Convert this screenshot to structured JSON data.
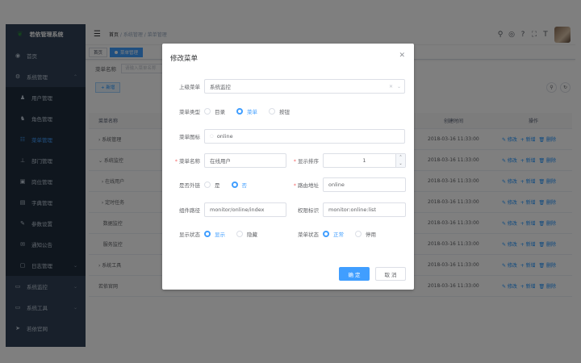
{
  "sidebar": {
    "logo_text": "若依管理系统",
    "items": [
      {
        "label": "首页",
        "icon": "dashboard-icon"
      },
      {
        "label": "系统管理",
        "icon": "gear-icon"
      },
      {
        "label": "用户管理",
        "icon": "user-icon"
      },
      {
        "label": "角色管理",
        "icon": "peoples-icon"
      },
      {
        "label": "菜单管理",
        "icon": "tree-table-icon"
      },
      {
        "label": "部门管理",
        "icon": "tree-icon"
      },
      {
        "label": "岗位管理",
        "icon": "post-icon"
      },
      {
        "label": "字典管理",
        "icon": "dict-icon"
      },
      {
        "label": "参数设置",
        "icon": "edit-icon"
      },
      {
        "label": "通知公告",
        "icon": "message-icon"
      },
      {
        "label": "日志管理",
        "icon": "log-icon"
      },
      {
        "label": "系统监控",
        "icon": "monitor-icon"
      },
      {
        "label": "系统工具",
        "icon": "tool-icon"
      },
      {
        "label": "若依官网",
        "icon": "guide-icon"
      }
    ]
  },
  "navbar": {
    "crumb_1": "首页",
    "sep": "/",
    "crumb_2": "系统管理",
    "crumb_3": "菜单管理"
  },
  "tags": {
    "home": "首页",
    "active": "菜单管理"
  },
  "search": {
    "label": "菜单名称",
    "placeholder": "请输入菜单名称"
  },
  "toolbar": {
    "add_label": "+ 新增"
  },
  "table": {
    "headers": {
      "name": "菜单名称",
      "time": "创建时间",
      "op": "操作"
    },
    "rows": [
      {
        "name": "› 系统管理",
        "time": "2018-03-16 11:33:00",
        "op": "✎ 修改  + 新增  🗑 删除"
      },
      {
        "name": "⌄ 系统监控",
        "time": "2018-03-16 11:33:00",
        "op": "✎ 修改  + 新增  🗑 删除"
      },
      {
        "name": "  › 在线用户",
        "time": "2018-03-16 11:33:00",
        "op": "✎ 修改  + 新增  🗑 删除"
      },
      {
        "name": "  › 定时任务",
        "time": "2018-03-16 11:33:00",
        "op": "✎ 修改  + 新增  🗑 删除"
      },
      {
        "name": "   数据监控",
        "time": "2018-03-16 11:33:00",
        "op": "✎ 修改  + 新增  🗑 删除"
      },
      {
        "name": "   服务监控",
        "time": "2018-03-16 11:33:00",
        "op": "✎ 修改  + 新增  🗑 删除"
      },
      {
        "name": "› 系统工具",
        "time": "2018-03-16 11:33:00",
        "op": "✎ 修改  + 新增  🗑 删除"
      },
      {
        "name": "若依官网",
        "time": "2018-03-16 11:33:00",
        "op": "✎ 修改  + 新增  🗑 删除"
      }
    ]
  },
  "dialog": {
    "title": "修改菜单",
    "parent_label": "上级菜单",
    "parent_value": "系统监控",
    "type_label": "菜单类型",
    "type_options": [
      "目录",
      "菜单",
      "按钮"
    ],
    "type_selected": "菜单",
    "icon_label": "菜单图标",
    "icon_value": "online",
    "name_label": "菜单名称",
    "name_value": "在线用户",
    "order_label": "显示排序",
    "order_value": "1",
    "frame_label": "是否外链",
    "frame_options": [
      "是",
      "否"
    ],
    "frame_selected": "否",
    "path_label": "路由地址",
    "path_value": "online",
    "component_label": "组件路径",
    "component_value": "monitor/online/index",
    "perms_label": "权限标识",
    "perms_value": "monitor:online:list",
    "visible_label": "显示状态",
    "visible_options": [
      "显示",
      "隐藏"
    ],
    "visible_selected": "显示",
    "status_label": "菜单状态",
    "status_options": [
      "正常",
      "停用"
    ],
    "status_selected": "正常",
    "ok_label": "确 定",
    "cancel_label": "取 消"
  },
  "colors": {
    "primary": "#409eff",
    "sidebar_bg": "#304156",
    "danger": "#f56c6c"
  }
}
